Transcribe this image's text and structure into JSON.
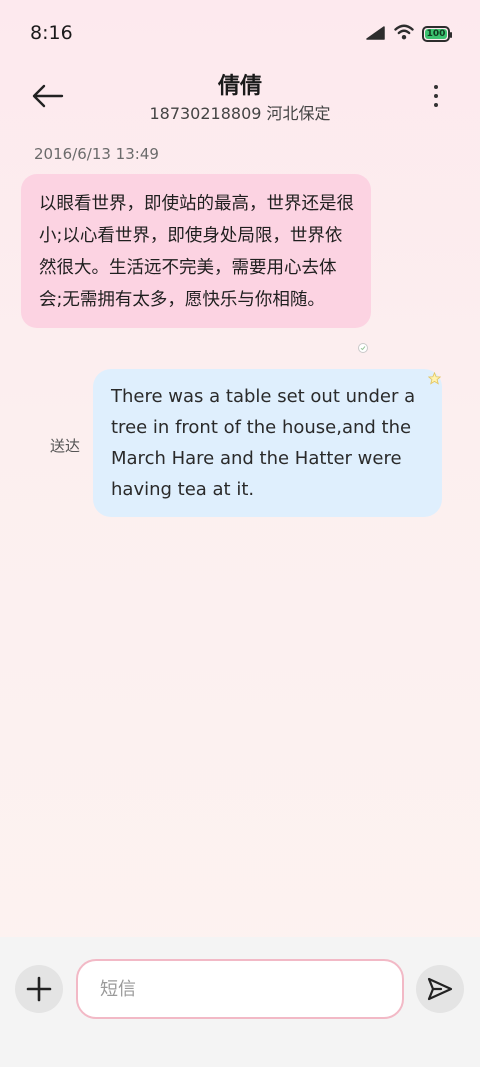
{
  "status_bar": {
    "time": "8:16",
    "battery_level": "100",
    "icons": [
      "signal-icon",
      "wifi-icon",
      "battery-icon"
    ],
    "battery_color": "#3cc270"
  },
  "header": {
    "back_icon": "arrow-left-icon",
    "contact_name": "倩倩",
    "contact_subtitle": "18730218809 河北保定",
    "more_icon": "more-vertical-icon"
  },
  "conversation": {
    "timestamp": "2016/6/13 13:49",
    "messages": [
      {
        "direction": "incoming",
        "text": "以眼看世界，即使站的最高，世界还是很小;以心看世界，即使身处局限，世界依然很大。生活远不完美，需要用心去体会;无需拥有太多，愿快乐与你相随。",
        "bubble_color": "#fcd3e2"
      },
      {
        "direction": "outgoing",
        "status": "送达",
        "text": "There was a table set out under a tree in front of the house,and the March Hare and the Hatter were having tea at it.",
        "bubble_color": "#dfeffd"
      }
    ]
  },
  "input_bar": {
    "add_icon": "plus-icon",
    "placeholder": "短信",
    "value": "",
    "send_icon": "send-icon",
    "input_border_color": "#f2b9c6"
  }
}
